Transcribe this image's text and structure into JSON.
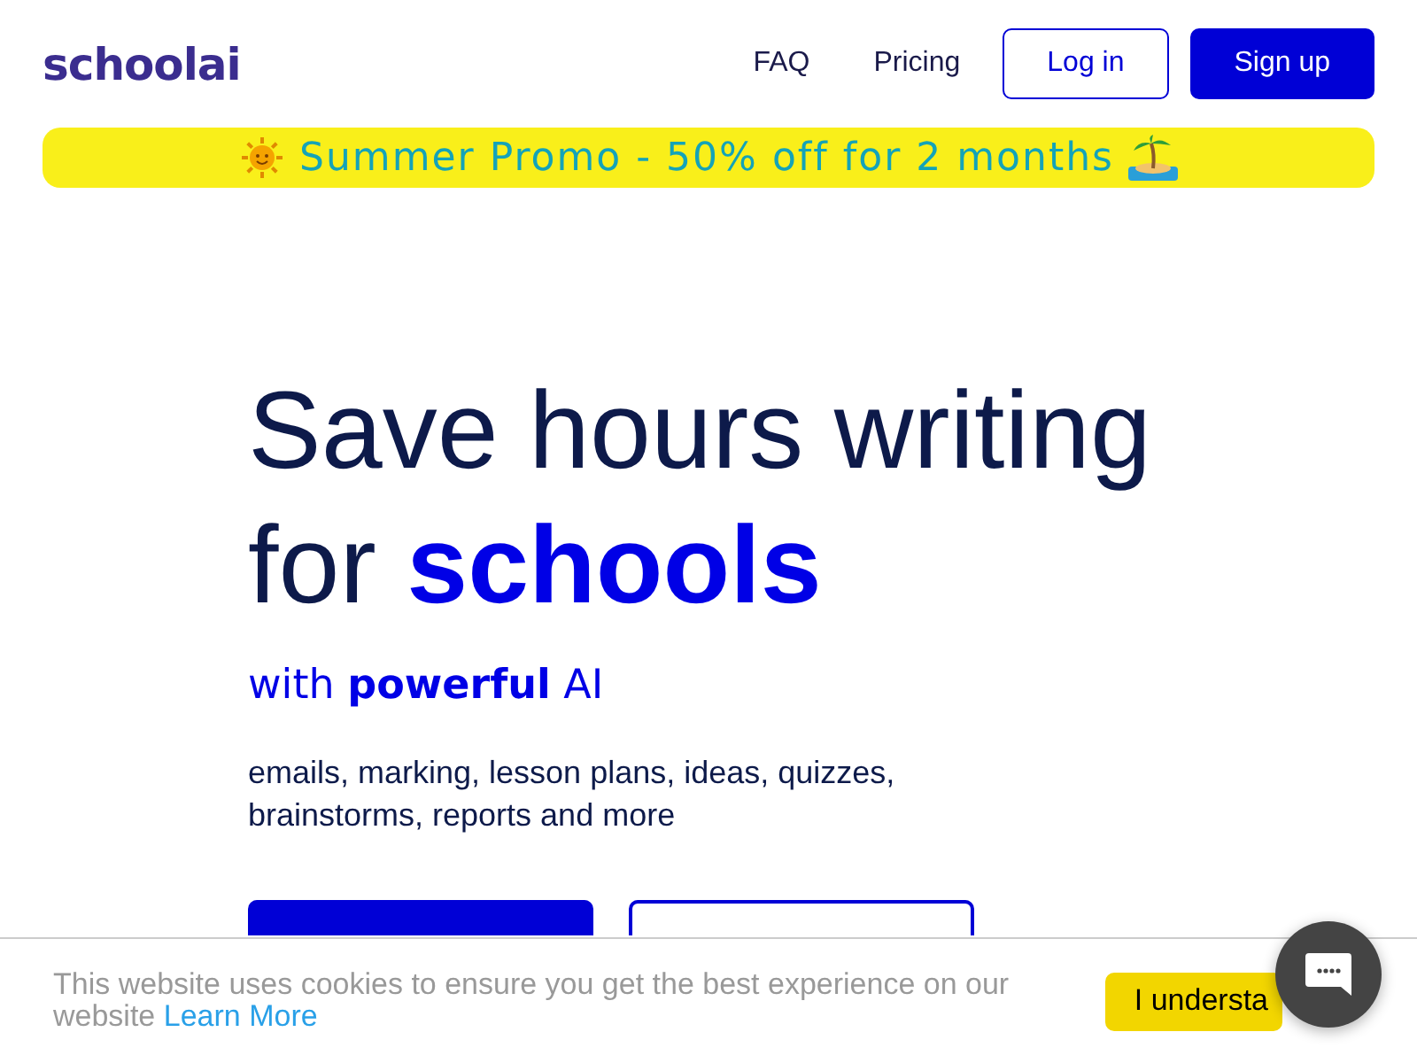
{
  "logo": "schoolai",
  "nav": [
    {
      "label": "FAQ",
      "kind": "link"
    },
    {
      "label": "Pricing",
      "kind": "link"
    },
    {
      "label": "Log in",
      "kind": "outline"
    },
    {
      "label": "Sign up",
      "kind": "solid"
    }
  ],
  "promo": {
    "text": "Summer Promo - 50% off for 2 months"
  },
  "hero": {
    "title_line_1": "Save hours writing",
    "title_line_2": "for **schools**",
    "subtitle": "with **powerful** AI",
    "description": "emails, marking, lesson plans, ideas, quizzes, brainstorms, reports and more",
    "buttons": [
      {
        "kind": "solid"
      },
      {
        "kind": "outline"
      }
    ]
  },
  "cookie": {
    "text": "This website uses cookies to ensure you get the best experience on our website",
    "link": "Learn More",
    "button": "I understa"
  }
}
